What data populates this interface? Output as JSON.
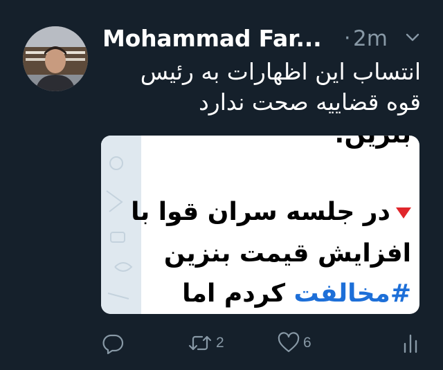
{
  "tweet": {
    "author_name": "Mohammad Far...",
    "separator": "·",
    "timestamp": "2m",
    "text_lines": [
      "انتساب این اظهارات به رئیس",
      "قوه قضاییه صحت ندارد"
    ],
    "media": {
      "line0": "بنزین:",
      "line1": "در جلسه سران قوا با",
      "line2": "افزایش قیمت بنزین",
      "line3_hashtag": "#مخالفت",
      "line3_rest": " کردم اما"
    },
    "actions": {
      "reply_count": "",
      "retweet_count": "2",
      "like_count": "6"
    }
  },
  "icons": {
    "caret": "chevron-down-icon",
    "reply": "reply-bubble-icon",
    "retweet": "retweet-icon",
    "like": "heart-icon",
    "share": "analytics-icon"
  },
  "colors": {
    "background": "#15202b",
    "muted": "#8899a6",
    "text": "#ffffff",
    "hashtag": "#1d6fd8",
    "triangle": "#e0262b"
  }
}
